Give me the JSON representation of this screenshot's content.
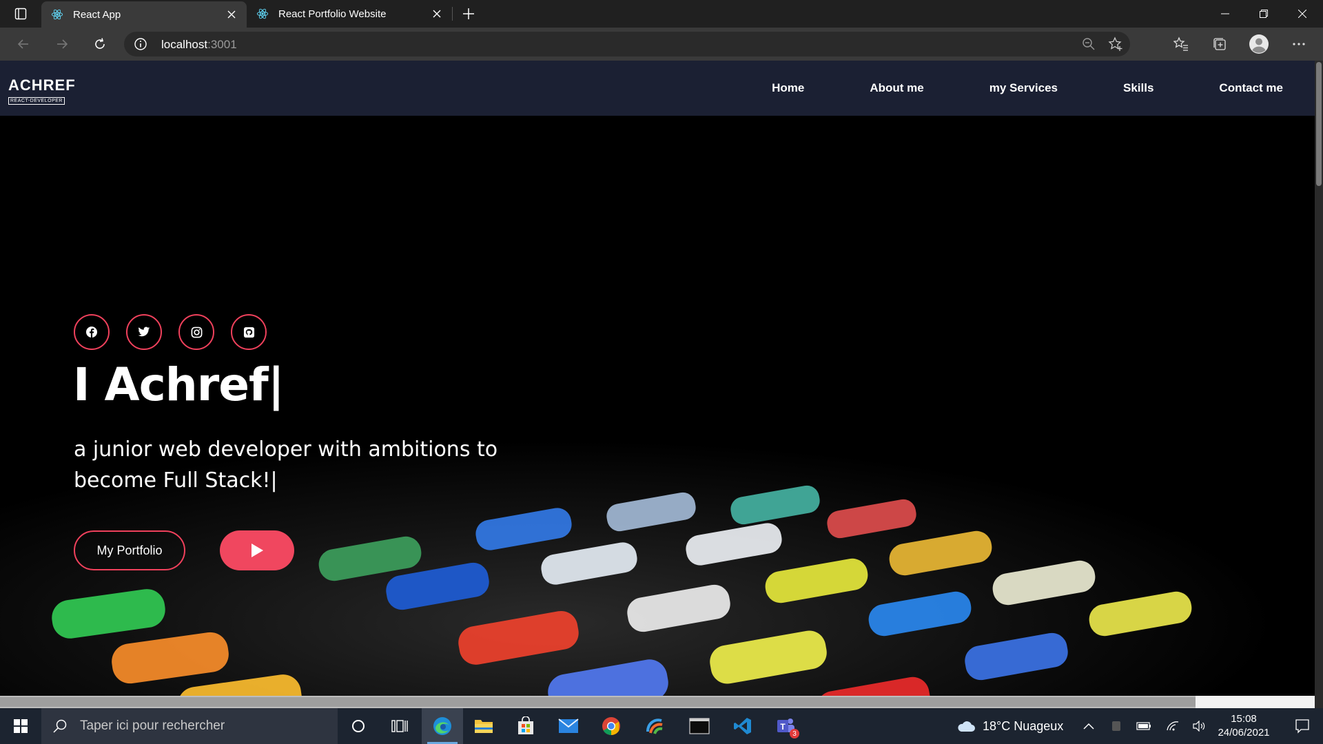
{
  "browser": {
    "tabs": [
      {
        "title": "React App",
        "active": true
      },
      {
        "title": "React Portfolio Website",
        "active": false
      }
    ],
    "url_host": "localhost",
    "url_port": ":3001"
  },
  "site": {
    "logo_main": "ACHREF",
    "logo_sub": "REACT-DEVELOPER",
    "nav": [
      "Home",
      "About me",
      "my Services",
      "Skills",
      "Contact me"
    ],
    "socials": [
      "facebook-icon",
      "twitter-icon",
      "instagram-icon",
      "github-icon"
    ],
    "hero_title": "I Achref|",
    "hero_subtitle_line1": "a junior web developer with ambitions to",
    "hero_subtitle_line2": "become Full Stack!|",
    "portfolio_button": "My Portfolio",
    "accent": "#f0415c"
  },
  "taskbar": {
    "search_placeholder": "Taper ici pour rechercher",
    "weather": "18°C  Nuageux",
    "time": "15:08",
    "date": "24/06/2021",
    "teams_badge": "3"
  }
}
